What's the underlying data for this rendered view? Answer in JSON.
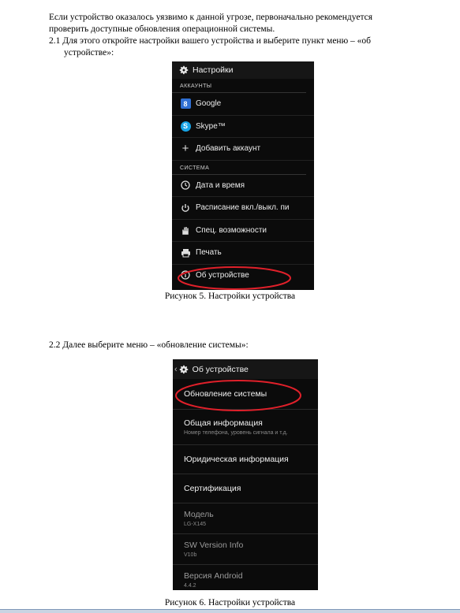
{
  "intro": {
    "line1": "Если устройство оказалось уязвимо к данной угрозе, первоначально рекомендуется",
    "line2": "проверить доступные обновления операционной системы."
  },
  "step1": {
    "line1": "2.1  Для этого откройте настройки вашего устройства и выберите пункт меню – «об",
    "line2": "устройстве»:"
  },
  "screen1": {
    "header": "Настройки",
    "section_accounts": "АККАУНТЫ",
    "section_system": "СИСТЕМА",
    "items": [
      {
        "label": "Google",
        "icon": "google-icon"
      },
      {
        "label": "Skype™",
        "icon": "skype-icon"
      },
      {
        "label": "Добавить аккаунт",
        "icon": "plus-icon"
      },
      {
        "label": "Дата и время",
        "icon": "clock-icon"
      },
      {
        "label": "Расписание вкл./выкл. пи",
        "icon": "power-schedule-icon"
      },
      {
        "label": "Спец. возможности",
        "icon": "hand-icon"
      },
      {
        "label": "Печать",
        "icon": "printer-icon"
      },
      {
        "label": "Об устройстве",
        "icon": "info-icon"
      }
    ],
    "highlight_color": "#e0202a"
  },
  "caption1": "Рисунок 5. Настройки устройства",
  "step2": "2.2  Далее выберите меню – «обновление системы»:",
  "screen2": {
    "header": "Об устройстве",
    "items": [
      {
        "title": "Обновление системы",
        "subtitle": ""
      },
      {
        "title": "Общая информация",
        "subtitle": "Номер телефона, уровень сигнала и т.д."
      },
      {
        "title": "Юридическая информация",
        "subtitle": ""
      },
      {
        "title": "Сертификация",
        "subtitle": ""
      },
      {
        "title": "Модель",
        "subtitle": "LG-X145"
      },
      {
        "title": "SW Version Info",
        "subtitle": "V10b"
      },
      {
        "title": "Версия Android",
        "subtitle": "4.4.2"
      }
    ]
  },
  "caption2": "Рисунок 6. Настройки устройства"
}
